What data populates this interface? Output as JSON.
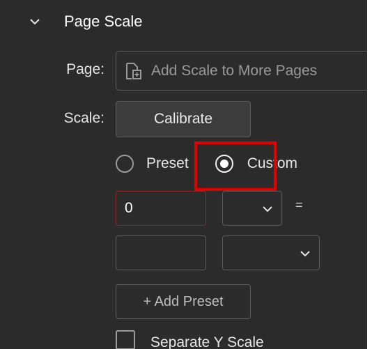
{
  "section": {
    "title": "Page Scale",
    "icon": "chevron-down-icon"
  },
  "page_row": {
    "label": "Page:",
    "button_label": "Add Scale to More Pages",
    "icon": "add-pages-icon"
  },
  "scale_row": {
    "label": "Scale:",
    "calibrate_label": "Calibrate"
  },
  "mode": {
    "options": [
      {
        "label": "Preset",
        "checked": false
      },
      {
        "label": "Custom",
        "checked": true
      }
    ]
  },
  "custom_scale": {
    "doc_value": "0",
    "doc_unit": "",
    "equals": "=",
    "real_value": "",
    "real_unit": ""
  },
  "add_preset_label": "+ Add Preset",
  "separate_y": {
    "label": "Separate Y Scale",
    "checked": false
  },
  "colors": {
    "panel_bg": "#2b2b2b",
    "highlight": "#e00000",
    "invalid_border": "#8e2a2a"
  }
}
